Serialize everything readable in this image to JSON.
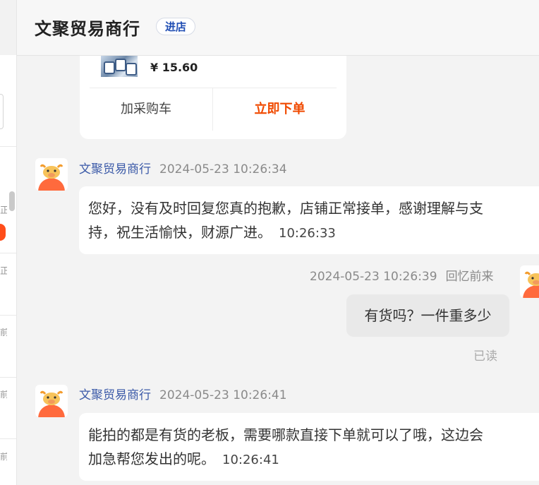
{
  "header": {
    "shop_name": "文聚贸易商行",
    "enter_store": "进店"
  },
  "left_list": {
    "snippets": [
      "正",
      "正",
      "前",
      "前",
      "前"
    ]
  },
  "product_card": {
    "price": "¥ 15.60",
    "add_to_cart": "加采购车",
    "buy_now": "立即下单"
  },
  "messages": [
    {
      "sender": "文聚贸易商行",
      "datetime": "2024-05-23 10:26:34",
      "line1": "您好，没有及时回复您真的抱歉，店铺正常接单，感谢理解与支",
      "line2": "持，祝生活愉快，财源广进。",
      "time": "10:26:33"
    },
    {
      "sender": "回忆前来",
      "datetime": "2024-05-23 10:26:39",
      "text": "有货吗？一件重多少",
      "status": "已读"
    },
    {
      "sender": "文聚贸易商行",
      "datetime": "2024-05-23 10:26:41",
      "line1": "能拍的都是有货的老板，需要哪款直接下单就可以了哦，这边会",
      "line2": "加急帮您发出的呢。",
      "time": "10:26:41"
    }
  ],
  "colors": {
    "accent_orange": "#f04a00",
    "link_blue": "#3b5aa8",
    "badge_orange": "#ff4d1a"
  }
}
